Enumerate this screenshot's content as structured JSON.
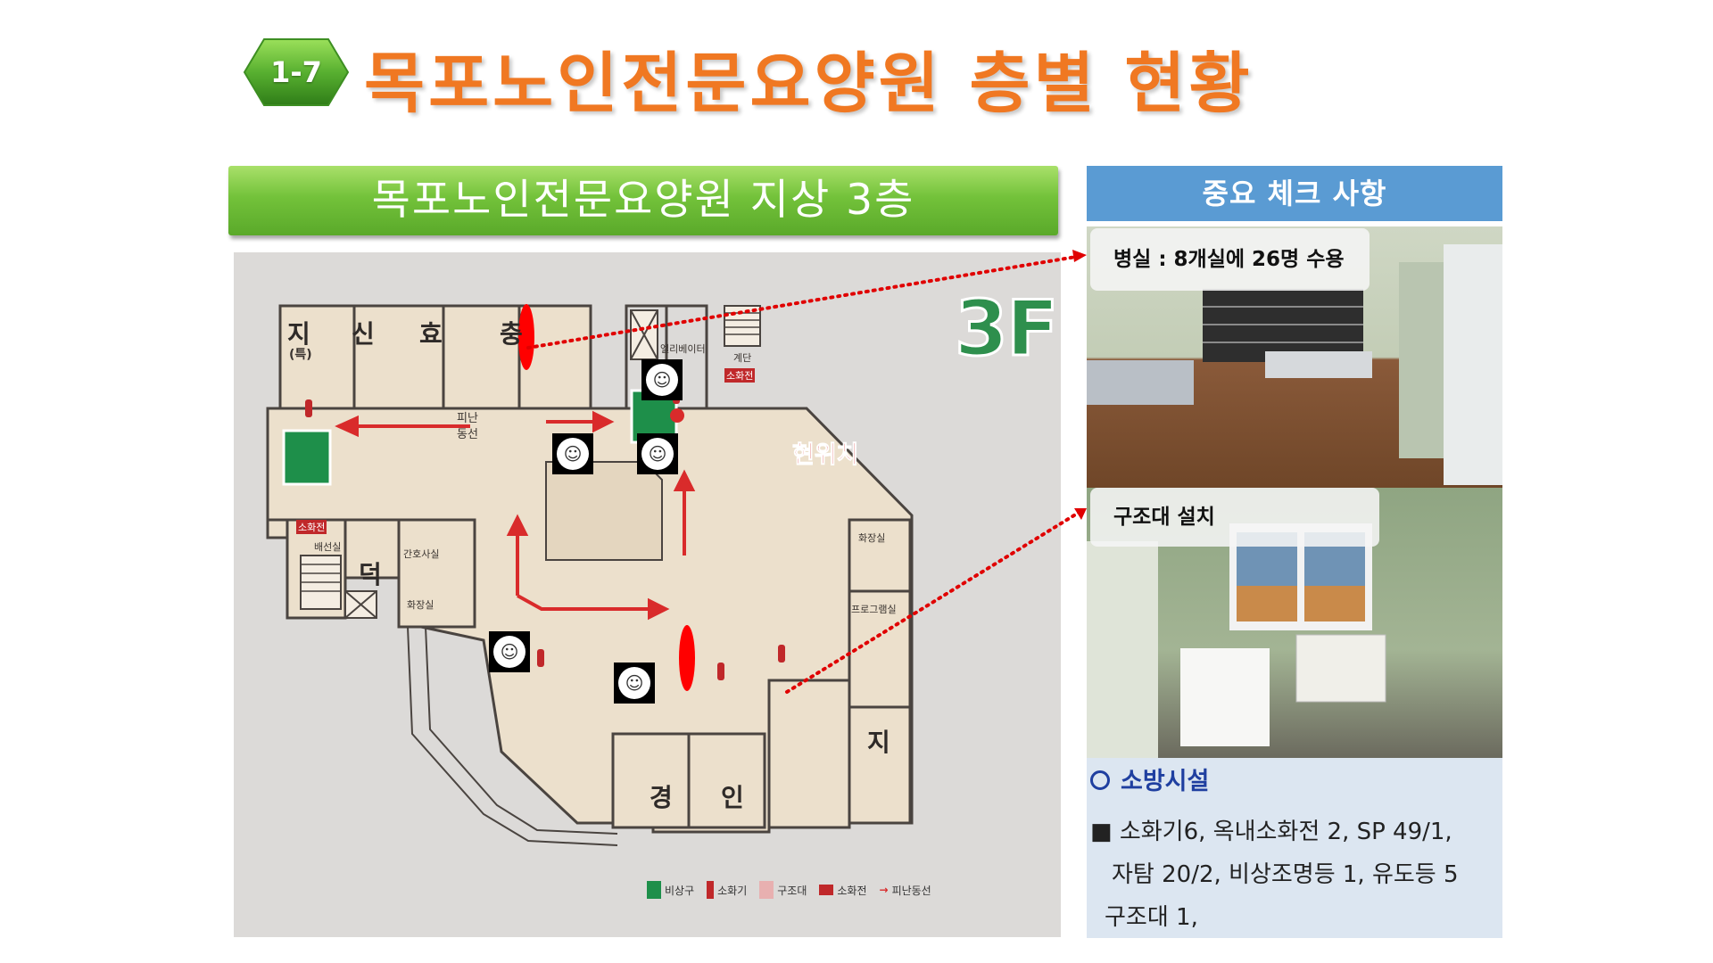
{
  "header": {
    "badge": "1-7",
    "title": "목포노인전문요양원 층별 현황"
  },
  "floor_section": {
    "title": "목포노인전문요양원 지상 3층"
  },
  "floor_plan": {
    "floor_sign": "3F",
    "current_location": "현위치",
    "rooms": [
      "지",
      "(특)",
      "신",
      "효",
      "충",
      "덕",
      "경",
      "인",
      "지"
    ],
    "small_labels": [
      "엘리베이터",
      "계단",
      "소화전",
      "피난",
      "동선",
      "화장실",
      "프로그램실",
      "간호사실",
      "배선실",
      "화장실",
      "소화전"
    ],
    "legend": [
      "비상구",
      "소화기",
      "구조대",
      "소화전",
      "피난동선"
    ]
  },
  "check_panel": {
    "title": "중요 체크 사항",
    "photo1_caption": "병실 : 8개실에 26명 수용",
    "photo2_caption": "구조대 설치",
    "fire_title": "소방시설",
    "fire_lines": [
      "■ 소화기6,  옥내소화전 2, SP 49/1,",
      "자탐 20/2, 비상조명등 1, 유도등 5",
      "구조대 1,"
    ]
  },
  "colors": {
    "title_orange": "#f07822",
    "header_green": "#73c23a",
    "panel_blue": "#5a9bd3",
    "fire_text_blue": "#1f3fa0",
    "arrow_red": "#d92b2b"
  }
}
